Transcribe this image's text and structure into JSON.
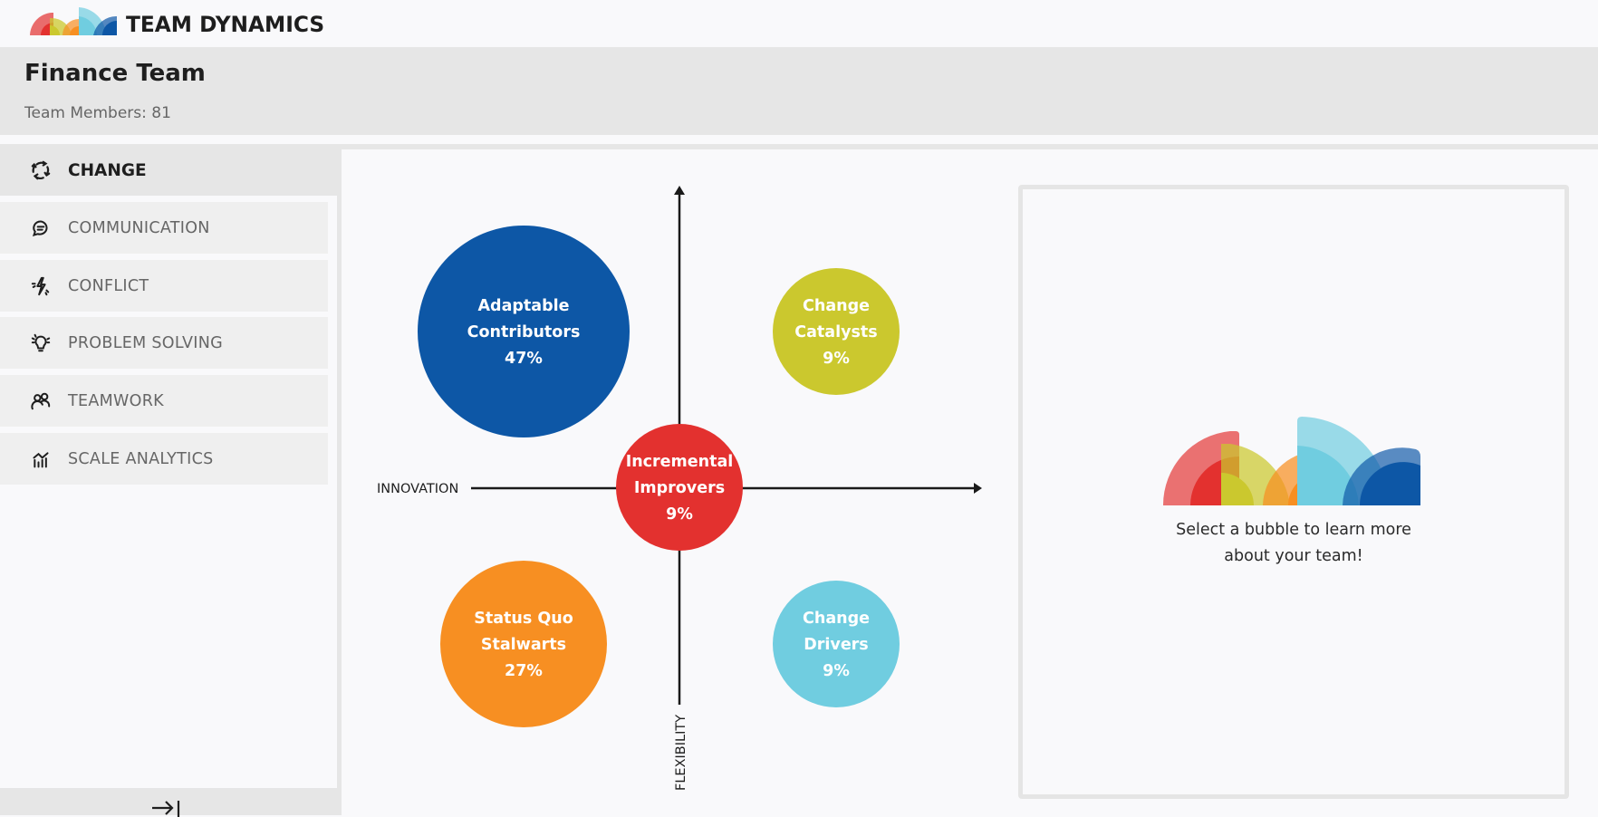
{
  "app": {
    "title": "TEAM DYNAMICS",
    "logo_icon": "team-dynamics-logo-icon"
  },
  "team": {
    "name": "Finance Team",
    "members_label": "Team Members: 81"
  },
  "sidebar": {
    "items": [
      {
        "label": "CHANGE",
        "icon": "change-cycle-icon",
        "active": true
      },
      {
        "label": "COMMUNICATION",
        "icon": "speech-bubble-icon",
        "active": false
      },
      {
        "label": "CONFLICT",
        "icon": "lightning-bolt-icon",
        "active": false
      },
      {
        "label": "PROBLEM SOLVING",
        "icon": "lightbulb-icon",
        "active": false
      },
      {
        "label": "TEAMWORK",
        "icon": "people-icon",
        "active": false
      },
      {
        "label": "SCALE ANALYTICS",
        "icon": "bar-chart-icon",
        "active": false
      }
    ],
    "collapse_icon": "collapse-arrow-icon"
  },
  "colors": {
    "blue": "#0d57a6",
    "yellow": "#cbc82e",
    "red": "#e3312f",
    "orange": "#f78f22",
    "cyan": "#70cde0",
    "axis": "#1a1a1a"
  },
  "chart_data": {
    "type": "scatter",
    "title": "",
    "xlabel": "INNOVATION",
    "ylabel": "FLEXIBILITY",
    "points": [
      {
        "name": "Adaptable Contributors",
        "line1": "Adaptable",
        "line2": "Contributors",
        "percent": 47,
        "label": "47%",
        "quadrant": "top-left",
        "color": "#0d57a6"
      },
      {
        "name": "Change Catalysts",
        "line1": "Change",
        "line2": "Catalysts",
        "percent": 9,
        "label": "9%",
        "quadrant": "top-right",
        "color": "#cbc82e"
      },
      {
        "name": "Incremental Improvers",
        "line1": "Incremental",
        "line2": "Improvers",
        "percent": 9,
        "label": "9%",
        "quadrant": "center",
        "color": "#e3312f"
      },
      {
        "name": "Status Quo Stalwarts",
        "line1": "Status Quo",
        "line2": "Stalwarts",
        "percent": 27,
        "label": "27%",
        "quadrant": "bottom-left",
        "color": "#f78f22"
      },
      {
        "name": "Change Drivers",
        "line1": "Change",
        "line2": "Drivers",
        "percent": 9,
        "label": "9%",
        "quadrant": "bottom-right",
        "color": "#70cde0"
      }
    ]
  },
  "info_panel": {
    "line1": "Select a bubble to learn more",
    "line2": "about your team!"
  }
}
